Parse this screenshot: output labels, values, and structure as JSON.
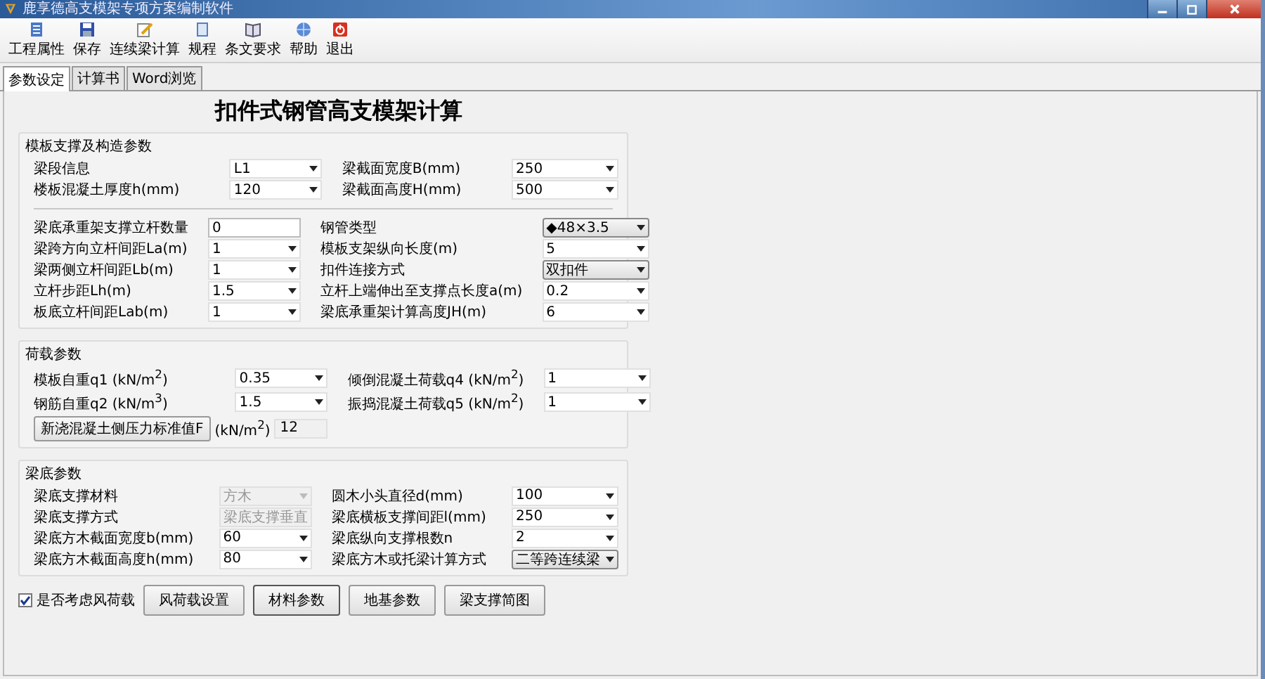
{
  "window": {
    "title": "鹿享德高支模架专项方案编制软件"
  },
  "toolbar": [
    {
      "label": "工程属性"
    },
    {
      "label": "保存"
    },
    {
      "label": "连续梁计算"
    },
    {
      "label": "规程"
    },
    {
      "label": "条文要求"
    },
    {
      "label": "帮助"
    },
    {
      "label": "退出"
    }
  ],
  "tabs": [
    {
      "label": "参数设定",
      "selected": true
    },
    {
      "label": "计算书",
      "selected": false
    },
    {
      "label": "Word浏览",
      "selected": false
    }
  ],
  "heading": "扣件式钢管高支模架计算",
  "sections": [
    {
      "title": "模板支撑及构造参数",
      "groups": [
        [
          {
            "left": {
              "label": "梁段信息",
              "value": "L1",
              "kind": "select"
            },
            "right": {
              "label": "梁截面宽度B(mm)",
              "value": "250",
              "kind": "select"
            }
          },
          {
            "left": {
              "label": "楼板混凝土厚度h(mm)",
              "value": "120",
              "kind": "select"
            },
            "right": {
              "label": "梁截面高度H(mm)",
              "value": "500",
              "kind": "select"
            }
          }
        ],
        [
          {
            "left": {
              "label": "梁底承重架支撑立杆数量",
              "value": "0",
              "kind": "input"
            },
            "right": {
              "label": "钢管类型",
              "value": "◆48×3.5",
              "kind": "combo"
            }
          },
          {
            "left": {
              "label": "梁跨方向立杆间距La(m)",
              "value": "1",
              "kind": "select"
            },
            "right": {
              "label": "模板支架纵向长度(m)",
              "value": "5",
              "kind": "select"
            }
          },
          {
            "left": {
              "label": "梁两侧立杆间距Lb(m)",
              "value": "1",
              "kind": "select"
            },
            "right": {
              "label": "扣件连接方式",
              "value": "双扣件",
              "kind": "combo"
            }
          },
          {
            "left": {
              "label": "立杆步距Lh(m)",
              "value": "1.5",
              "kind": "select"
            },
            "right": {
              "label": "立杆上端伸出至支撑点长度a(m)",
              "value": "0.2",
              "kind": "select"
            }
          },
          {
            "left": {
              "label": "板底立杆间距Lab(m)",
              "value": "1",
              "kind": "select"
            },
            "right": {
              "label": "梁底承重架计算高度JH(m)",
              "value": "6",
              "kind": "select"
            }
          }
        ]
      ]
    },
    {
      "title": "荷载参数",
      "groups": [
        [
          {
            "left": {
              "label": "模板自重q1 (kN/m$^{2}$)",
              "value": "0.35",
              "kind": "select"
            },
            "right": {
              "label": "倾倒混凝土荷载q4 (kN/m$^{2}$)",
              "value": "1",
              "kind": "select"
            }
          },
          {
            "left": {
              "label": "钢筋自重q2 (kN/m$^{3}$)",
              "value": "1.5",
              "kind": "select"
            },
            "right": {
              "label": "振捣混凝土荷载q5 (kN/m$^{2}$)",
              "value": "1",
              "kind": "select"
            }
          },
          {
            "left": {
              "label": "新浇混凝土侧压力标准值F",
              "unit": "(kN/m$^{2}$)",
              "value": "12",
              "kind": "button"
            }
          }
        ]
      ]
    },
    {
      "title": "梁底参数",
      "groups": [
        [
          {
            "left": {
              "label": "梁底支撑材料",
              "value": "方木",
              "kind": "select",
              "disabled": true
            },
            "right": {
              "label": "圆木小头直径d(mm)",
              "value": "100",
              "kind": "select"
            }
          },
          {
            "left": {
              "label": "梁底支撑方式",
              "value": "梁底支撑垂直",
              "kind": "select",
              "disabled": true
            },
            "right": {
              "label": "梁底横板支撑间距l(mm)",
              "value": "250",
              "kind": "select"
            }
          },
          {
            "left": {
              "label": "梁底方木截面宽度b(mm)",
              "value": "60",
              "kind": "select"
            },
            "right": {
              "label": "梁底纵向支撑根数n",
              "value": "2",
              "kind": "select"
            }
          },
          {
            "left": {
              "label": "梁底方木截面高度h(mm)",
              "value": "80",
              "kind": "select"
            },
            "right": {
              "label": "梁底方木或托梁计算方式",
              "value": "二等跨连续梁",
              "kind": "combo"
            }
          }
        ]
      ]
    }
  ],
  "wind_checkbox": {
    "label": "是否考虑风荷载",
    "checked": true
  },
  "buttons": [
    {
      "label": "风荷载设置",
      "focused": false
    },
    {
      "label": "材料参数",
      "focused": true
    },
    {
      "label": "地基参数",
      "focused": false
    },
    {
      "label": "梁支撑简图",
      "focused": false
    }
  ]
}
